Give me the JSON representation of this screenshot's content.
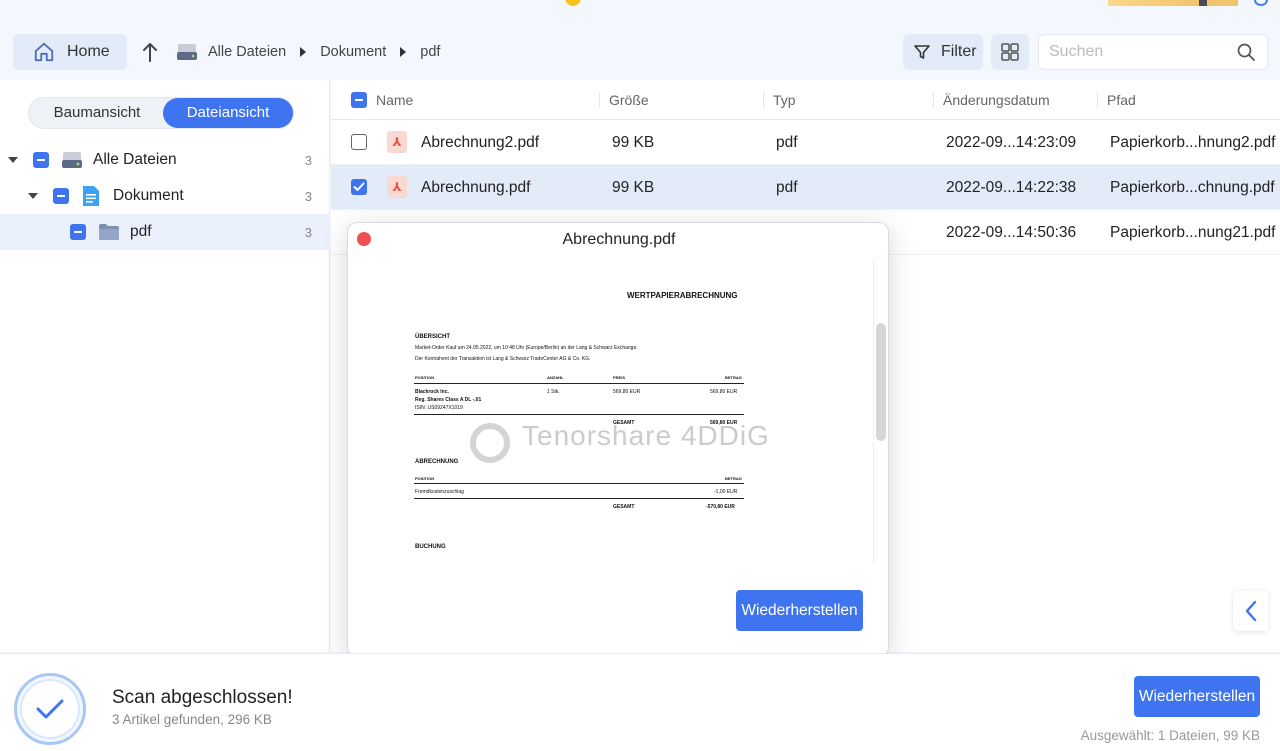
{
  "toolbar": {
    "home_label": "Home",
    "breadcrumb": [
      "Alle Dateien",
      "Dokument",
      "pdf"
    ],
    "filter_label": "Filter",
    "search_placeholder": "Suchen"
  },
  "sidebar": {
    "view_tree": "Baumansicht",
    "view_file": "Dateiansicht",
    "tree": [
      {
        "label": "Alle Dateien",
        "count": "3"
      },
      {
        "label": "Dokument",
        "count": "3"
      },
      {
        "label": "pdf",
        "count": "3"
      }
    ]
  },
  "table": {
    "headers": {
      "name": "Name",
      "size": "Größe",
      "type": "Typ",
      "date": "Änderungsdatum",
      "path": "Pfad"
    },
    "rows": [
      {
        "name": "Abrechnung2.pdf",
        "size": "99 KB",
        "type": "pdf",
        "date": "2022-09...14:23:09",
        "path": "Papierkorb...hnung2.pdf",
        "checked": false
      },
      {
        "name": "Abrechnung.pdf",
        "size": "99 KB",
        "type": "pdf",
        "date": "2022-09...14:22:38",
        "path": "Papierkorb...chnung.pdf",
        "checked": true
      },
      {
        "date": "2022-09...14:50:36",
        "path": "Papierkorb...nung21.pdf"
      }
    ]
  },
  "preview": {
    "title": "Abrechnung.pdf",
    "restore_label": "Wiederherstellen",
    "watermark": "Tenorshare 4DDiG",
    "doc": {
      "heading": "WERTPAPIERABRECHNUNG",
      "section1": "ÜBERSICHT",
      "line1": "Market-Order Kauf am 24.05.2022, um 10:48 Uhr (Europe/Berlin) an der Lang & Schwarz Exchange.",
      "line2": "Der Kontrahent der Transaktion ist Lang & Schwarz TradeCenter AG & Co. KG.",
      "col_position": "POSITION",
      "col_anzahl": "ANZAHL",
      "col_preis": "PREIS",
      "col_betrag": "BETRAG",
      "pos1": "Blackrock Inc.",
      "pos2": "Reg. Shares Class A DL -,01",
      "pos3": "ISIN: US09247X1019",
      "anzahl": "1 Stk.",
      "preis": "569,80 EUR",
      "betrag": "569,80 EUR",
      "gesamt_label": "GESAMT",
      "gesamt1": "569,80 EUR",
      "section2": "ABRECHNUNG",
      "fremd": "Fremdkostenzuschlag",
      "fremd_betrag": "-1,00 EUR",
      "gesamt2": "-570,80 EUR",
      "section3": "BUCHUNG"
    }
  },
  "status": {
    "title": "Scan abgeschlossen!",
    "subtitle": "3 Artikel gefunden,  296 KB",
    "restore_label": "Wiederherstellen",
    "selected": "Ausgewählt: 1 Dateien, 99 KB"
  },
  "colors": {
    "accent": "#3f74f0",
    "pdf": "#e8533c",
    "close": "#ee4f4f"
  }
}
